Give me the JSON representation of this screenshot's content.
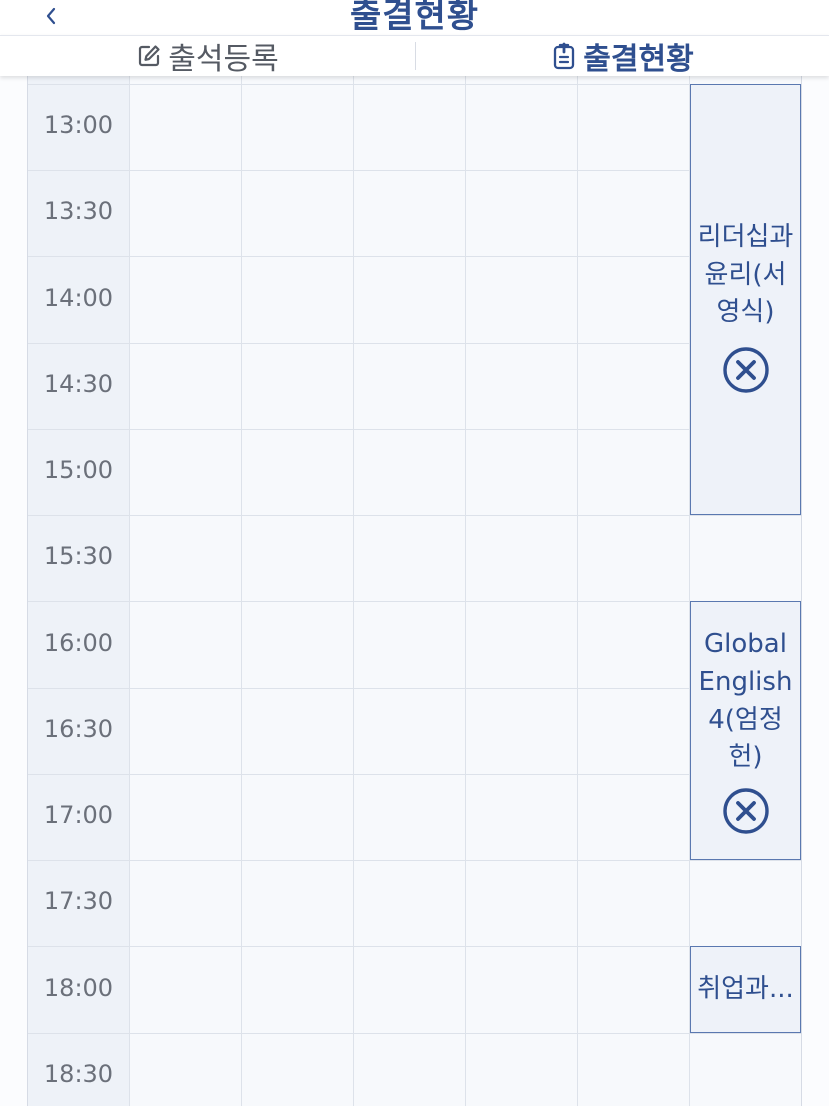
{
  "header": {
    "title": "출결현황",
    "back_icon": "chevron-left-icon"
  },
  "tabs": [
    {
      "label": "출석등록",
      "icon": "edit-icon",
      "active": false
    },
    {
      "label": "출결현황",
      "icon": "clipboard-icon",
      "active": true
    }
  ],
  "timetable": {
    "time_slots": [
      "13:00",
      "13:30",
      "14:00",
      "14:30",
      "15:00",
      "15:30",
      "16:00",
      "16:30",
      "17:00",
      "17:30",
      "18:00",
      "18:30"
    ],
    "classes": [
      {
        "name": "리더십과윤리(서영식)",
        "start": "13:00",
        "end": "15:30",
        "status_icon": "absent-x-circle-icon"
      },
      {
        "name": "Global English 4(엄정헌)",
        "start": "16:00",
        "end": "17:30",
        "status_icon": "absent-x-circle-icon"
      },
      {
        "name": "취업과...",
        "start": "18:00",
        "end": "18:30"
      }
    ]
  },
  "colors": {
    "accent": "#2f4f8f",
    "block_border": "#5a78b0",
    "block_bg": "#eef2f9",
    "time_col_bg": "#eef2f8",
    "grid_bg": "#f7f9fc"
  }
}
